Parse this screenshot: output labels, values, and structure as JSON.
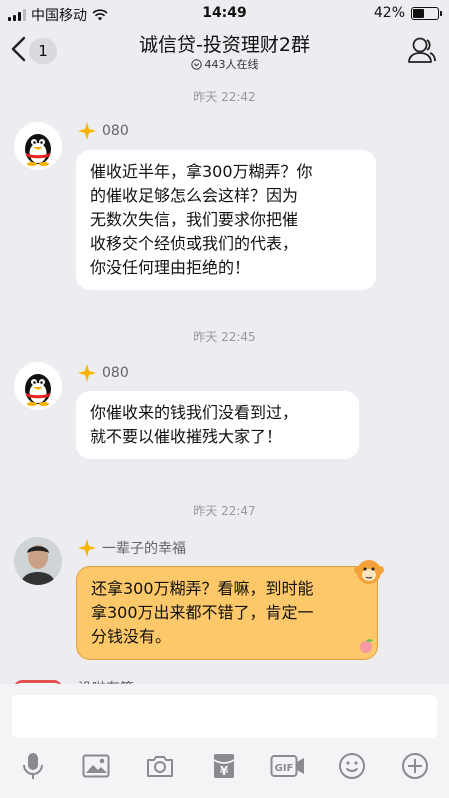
{
  "status": {
    "carrier": "中国移动",
    "time": "14:49",
    "battery": "42%",
    "battery_level": 0.42
  },
  "header": {
    "title": "诚信贷-投资理财2群",
    "online": "443人在线",
    "unread": "1"
  },
  "messages": [
    {
      "time": "昨天 22:42",
      "nick": "080",
      "text": [
        "催收近半年，拿300万糊弄？你",
        "的催收足够怎么会这样？因为",
        "无数次失信，我们要求你把催",
        "收移交个经侦或我们的代表，",
        "你没任何理由拒绝的！"
      ]
    },
    {
      "time": "昨天 22:45",
      "nick": "080",
      "text": [
        "你催收来的钱我们没看到过，",
        "就不要以催收摧残大家了！"
      ]
    },
    {
      "time": "昨天 22:47",
      "nick": "一辈子的幸福",
      "text": [
        "还拿300万糊弄？看嘛，到时能",
        "拿300万出来都不错了，肯定一",
        "分钱没有。"
      ]
    }
  ],
  "partial_nick": "没啦有等",
  "colors": {
    "background": "#ececf1",
    "bubble": "#ffffff",
    "bubble_highlight": "#fcc86a",
    "bubble_highlight_border": "#e2a13c",
    "icons": "#8a8a8f"
  },
  "toolbar": [
    "mic-icon",
    "image-icon",
    "camera-icon",
    "red-packet-icon",
    "gif-icon",
    "emoji-icon",
    "plus-icon"
  ],
  "toolbar_labels": {
    "gif": "GIF",
    "yuan": "¥"
  }
}
